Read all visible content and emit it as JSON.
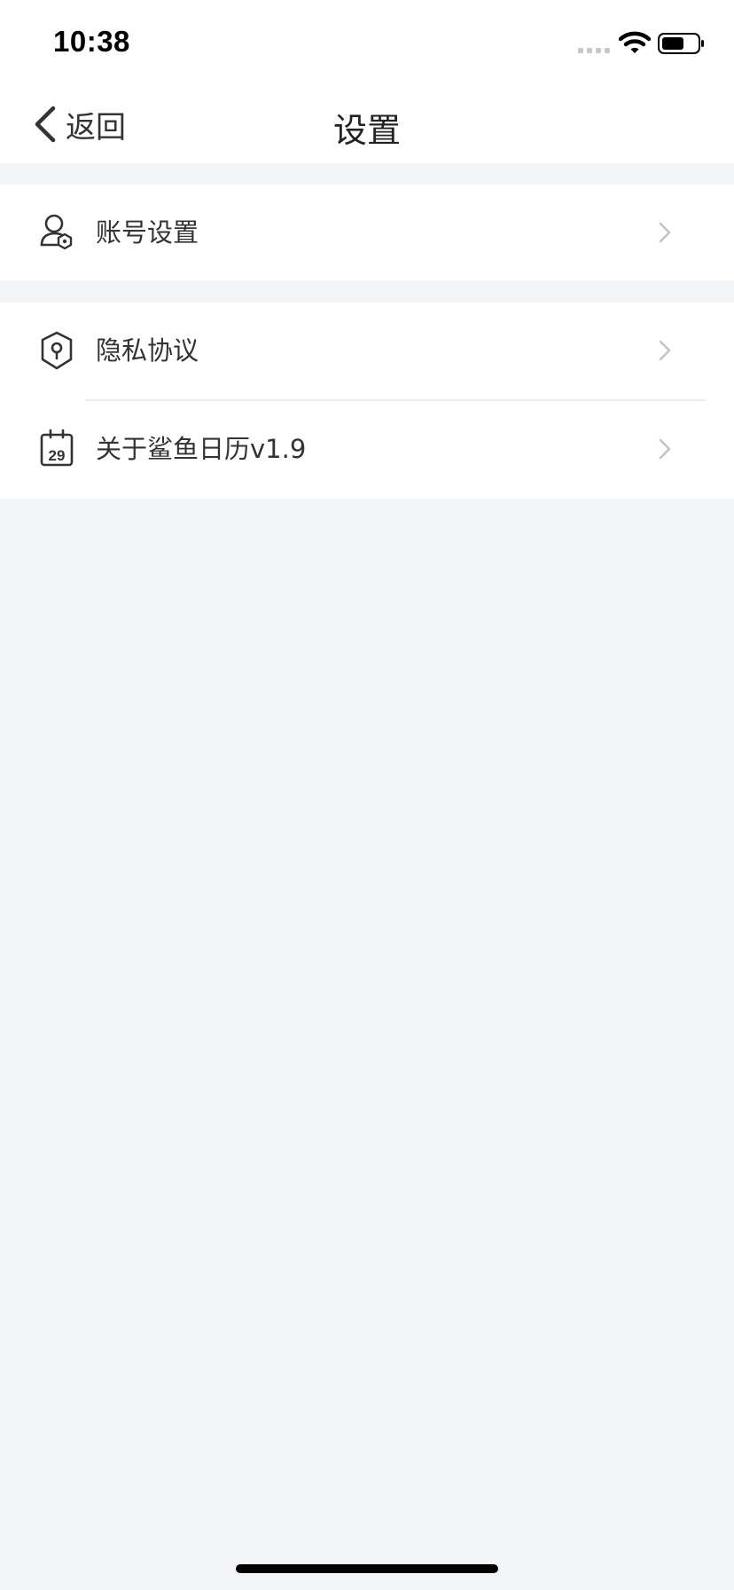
{
  "status_bar": {
    "time": "10:38",
    "icons": [
      "signal-icon",
      "wifi-icon",
      "battery-icon"
    ]
  },
  "nav": {
    "back_label": "返回",
    "title": "设置",
    "back_icon": "chevron-left-icon"
  },
  "sections": [
    {
      "items": [
        {
          "label": "账号设置",
          "icon": "user-gear-icon"
        }
      ]
    },
    {
      "items": [
        {
          "label": "隐私协议",
          "icon": "privacy-shield-icon"
        },
        {
          "label": "关于鲨鱼日历v1.9",
          "icon": "calendar-icon"
        }
      ]
    }
  ],
  "colors": {
    "background": "#f4f5f7",
    "surface": "#ffffff",
    "text": "#333333",
    "chevron": "#c4c4c4",
    "divider": "#ececec"
  }
}
